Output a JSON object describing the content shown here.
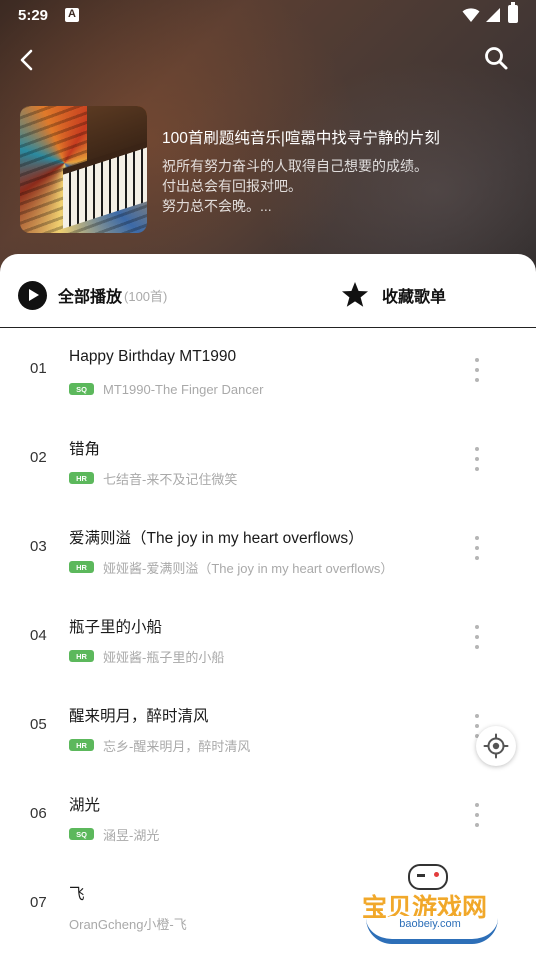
{
  "status_bar": {
    "time": "5:29"
  },
  "header": {
    "back_icon": "chevron-left-icon",
    "search_icon": "search-icon",
    "playlist_title": "100首刷题纯音乐|喧嚣中找寻宁静的片刻",
    "description_lines": [
      "祝所有努力奋斗的人取得自己想要的成绩。",
      "付出总会有回报对吧。",
      "努力总不会晚。..."
    ]
  },
  "actions": {
    "play_all_label": "全部播放",
    "play_all_count": "(100首)",
    "collect_label": "收藏歌单"
  },
  "songs": [
    {
      "num": "01",
      "title": "Happy Birthday MT1990",
      "badge": "SQ",
      "artist": "MT1990-The Finger Dancer"
    },
    {
      "num": "02",
      "title": "错角",
      "badge": "HR",
      "artist": "七结音-来不及记住微笑"
    },
    {
      "num": "03",
      "title": "爱满则溢（The joy in my heart overflows）",
      "badge": "HR",
      "artist": "娅娅酱-爱满则溢（The joy in my heart overflows）"
    },
    {
      "num": "04",
      "title": "瓶子里的小船",
      "badge": "HR",
      "artist": "娅娅酱-瓶子里的小船"
    },
    {
      "num": "05",
      "title": "醒来明月，醉时清风",
      "badge": "HR",
      "artist": "忘乡-醒来明月，醉时清风"
    },
    {
      "num": "06",
      "title": "湖光",
      "badge": "SQ",
      "artist": "涵昱-湖光"
    },
    {
      "num": "07",
      "title": "飞",
      "badge": "",
      "artist": "OranGcheng小橙-飞"
    }
  ],
  "watermark": {
    "title": "宝贝游戏网",
    "url": "baobeiy.com"
  },
  "colors": {
    "badge_green": "#5cb85c",
    "watermark_orange": "#f1a82a",
    "watermark_blue": "#2d6fb8"
  }
}
